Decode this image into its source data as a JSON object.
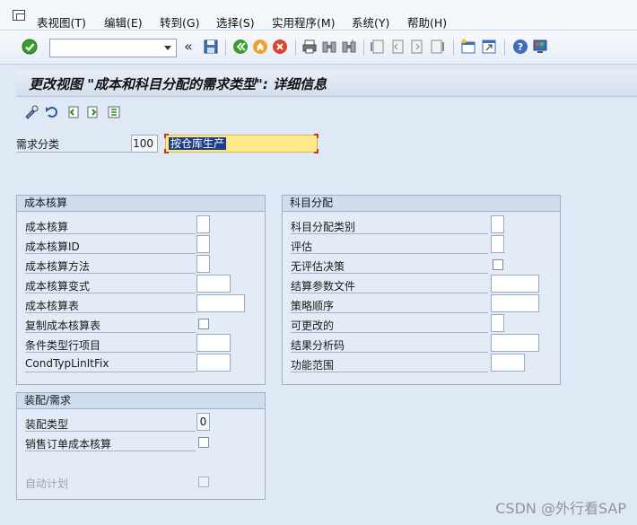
{
  "menu": {
    "items": [
      "表视图(T)",
      "编辑(E)",
      "转到(G)",
      "选择(S)",
      "实用程序(M)",
      "系统(Y)",
      "帮助(H)"
    ]
  },
  "toolbar": {
    "command_value": "",
    "back_label": "«"
  },
  "title": "更改视图 \"成本和科目分配的需求类型\": 详细信息",
  "header": {
    "req_class_label": "需求分类",
    "req_class_value": "100",
    "req_class_desc": "按仓库生产"
  },
  "cost_group": {
    "title": "成本核算",
    "rows": [
      {
        "label": "成本核算",
        "kind": "checkbox-box",
        "value": ""
      },
      {
        "label": "成本核算ID",
        "kind": "checkbox-box",
        "value": ""
      },
      {
        "label": "成本核算方法",
        "kind": "checkbox-box",
        "value": ""
      },
      {
        "label": "成本核算变式",
        "kind": "input",
        "value": ""
      },
      {
        "label": "成本核算表",
        "kind": "input-wide",
        "value": ""
      },
      {
        "label": "复制成本核算表",
        "kind": "checkbox",
        "value": ""
      },
      {
        "label": "条件类型行项目",
        "kind": "input",
        "value": ""
      },
      {
        "label": "CondTypLinItFix",
        "kind": "input",
        "value": ""
      }
    ]
  },
  "acct_group": {
    "title": "科目分配",
    "rows": [
      {
        "label": "科目分配类别",
        "kind": "checkbox-box",
        "value": ""
      },
      {
        "label": "评估",
        "kind": "checkbox-box",
        "value": ""
      },
      {
        "label": "无评估决策",
        "kind": "checkbox",
        "value": ""
      },
      {
        "label": "结算参数文件",
        "kind": "input-wide",
        "value": ""
      },
      {
        "label": "策略顺序",
        "kind": "input-wide",
        "value": ""
      },
      {
        "label": "可更改的",
        "kind": "checkbox-box",
        "value": ""
      },
      {
        "label": "结果分析码",
        "kind": "input-wide",
        "value": ""
      },
      {
        "label": "功能范围",
        "kind": "input",
        "value": ""
      }
    ]
  },
  "config_group": {
    "title": "装配/需求",
    "assembly_type_label": "装配类型",
    "assembly_type_value": "0",
    "sales_order_costing_label": "销售订单成本核算",
    "auto_planning_label": "自动计划"
  },
  "watermark": "CSDN @外行看SAP"
}
